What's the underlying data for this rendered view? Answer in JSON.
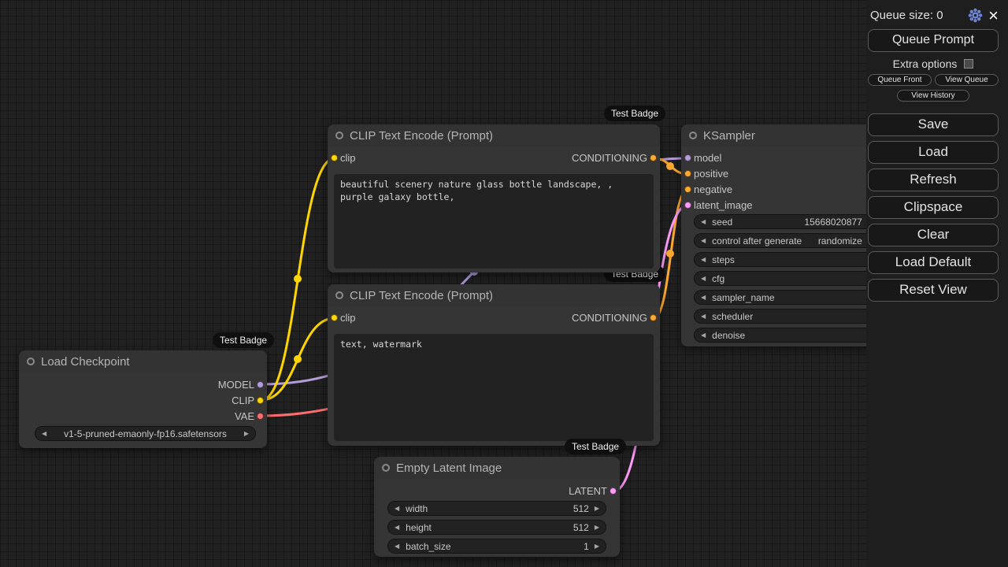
{
  "menu": {
    "queue_size": "Queue size: 0",
    "queue_prompt": "Queue Prompt",
    "extra_options": "Extra options",
    "queue_front": "Queue Front",
    "view_queue": "View Queue",
    "view_history": "View History",
    "actions": [
      "Save",
      "Load",
      "Refresh",
      "Clipspace",
      "Clear",
      "Load Default",
      "Reset View"
    ],
    "close": "×"
  },
  "badges": {
    "text": "Test Badge"
  },
  "nodes": {
    "load_checkpoint": {
      "title": "Load Checkpoint",
      "outputs": {
        "model": "MODEL",
        "clip": "CLIP",
        "vae": "VAE"
      },
      "ckpt_name": "v1-5-pruned-emaonly-fp16.safetensors"
    },
    "clip_positive": {
      "title": "CLIP Text Encode (Prompt)",
      "input": "clip",
      "output": "CONDITIONING",
      "text": "beautiful scenery nature glass bottle landscape, , purple galaxy bottle,"
    },
    "clip_negative": {
      "title": "CLIP Text Encode (Prompt)",
      "input": "clip",
      "output": "CONDITIONING",
      "text": "text, watermark"
    },
    "ksampler": {
      "title": "KSampler",
      "inputs": [
        "model",
        "positive",
        "negative",
        "latent_image"
      ],
      "widgets": [
        {
          "label": "seed",
          "value": "15668020877"
        },
        {
          "label": "control after generate",
          "value": "randomize"
        },
        {
          "label": "steps",
          "value": ""
        },
        {
          "label": "cfg",
          "value": ""
        },
        {
          "label": "sampler_name",
          "value": ""
        },
        {
          "label": "scheduler",
          "value": ""
        },
        {
          "label": "denoise",
          "value": ""
        }
      ]
    },
    "empty_latent": {
      "title": "Empty Latent Image",
      "output": "LATENT",
      "widgets": [
        {
          "label": "width",
          "value": "512"
        },
        {
          "label": "height",
          "value": "512"
        },
        {
          "label": "batch_size",
          "value": "1"
        }
      ]
    }
  },
  "colors": {
    "model": "#B39DDB",
    "clip": "#FFD500",
    "vae": "#FF6E6E",
    "conditioning": "#FFA931",
    "latent": "#FF9CF9"
  }
}
